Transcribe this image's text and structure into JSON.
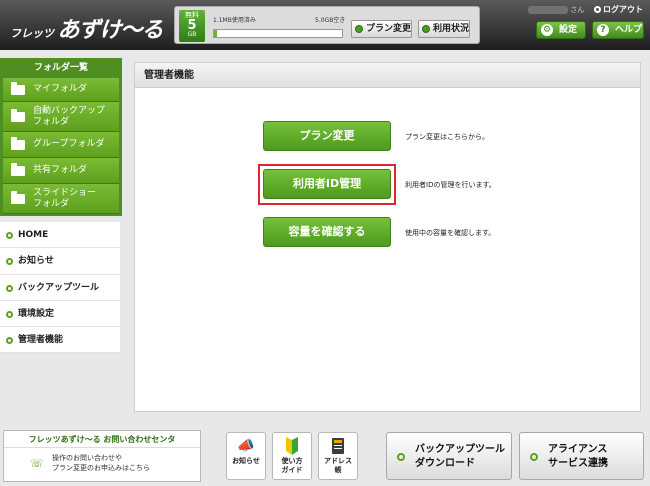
{
  "header": {
    "logo_prefix": "フレッツ",
    "logo_main": "あずけ〜る",
    "plan_badge": {
      "line1": "無料",
      "line2": "5",
      "line3": "GB"
    },
    "usage_used": "1.1MB使用済み",
    "usage_free": "5.0GB空き",
    "usage_percent": 0.02,
    "plan_change_label": "プラン変更",
    "usage_status_label": "利用状況",
    "user_suffix": "さん",
    "logout_label": "ログアウト",
    "settings_label": "設定",
    "help_label": "ヘルプ",
    "accent_color": "#4f8f22"
  },
  "sidebar": {
    "folder_heading": "フォルダ一覧",
    "folders": [
      {
        "label": "マイフォルダ"
      },
      {
        "label": "自動バックアップ\nフォルダ"
      },
      {
        "label": "グループフォルダ"
      },
      {
        "label": "共有フォルダ"
      },
      {
        "label": "スライドショー\nフォルダ"
      }
    ],
    "nav": [
      {
        "label": "HOME"
      },
      {
        "label": "お知らせ"
      },
      {
        "label": "バックアップツール"
      },
      {
        "label": "環境設定"
      },
      {
        "label": "管理者機能"
      }
    ]
  },
  "main": {
    "title": "管理者機能",
    "actions": [
      {
        "label": "プラン変更",
        "desc": "プラン変更はこちらから。"
      },
      {
        "label": "利用者ID管理",
        "desc": "利用者IDの管理を行います。"
      },
      {
        "label": "容量を確認する",
        "desc": "使用中の容量を確認します。"
      }
    ],
    "highlight_color": "#e0262e"
  },
  "footer": {
    "contact_title": "フレッツあずけ〜る お問い合わせセンタ",
    "contact_line1": "操作のお問い合わせや",
    "contact_line2": "プラン変更のお申込みはこちら",
    "icon_buttons": [
      {
        "label": "お知らせ",
        "icon": "megaphone-icon"
      },
      {
        "label": "使い方\nガイド",
        "icon": "beginner-mark-icon"
      },
      {
        "label": "アドレス\n帳",
        "icon": "address-book-icon"
      }
    ],
    "backup_tool_download": "バックアップツール\nダウンロード",
    "alliance_service": "アライアンス\nサービス連携"
  }
}
